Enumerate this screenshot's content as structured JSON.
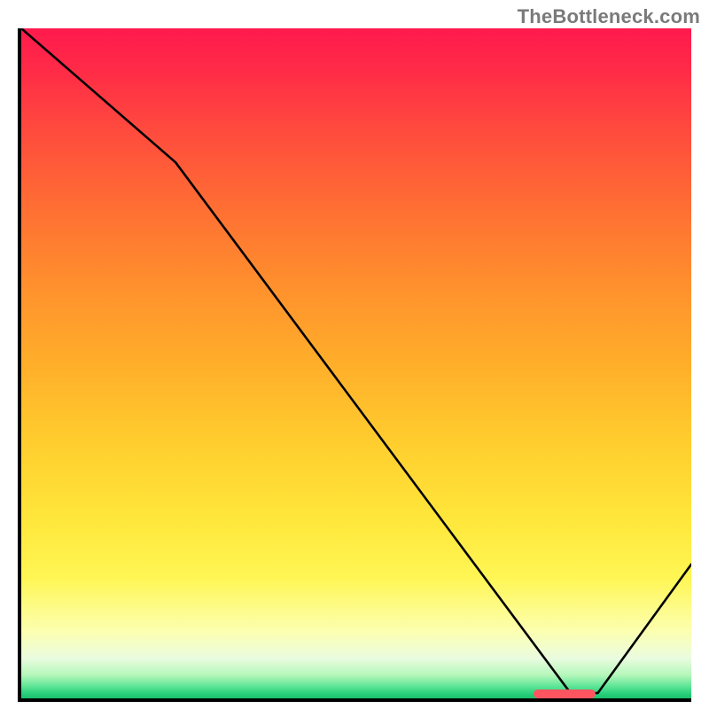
{
  "watermark": "TheBottleneck.com",
  "chart_data": {
    "type": "line",
    "title": "",
    "xlabel": "",
    "ylabel": "",
    "xlim": [
      0,
      100
    ],
    "ylim": [
      0,
      100
    ],
    "x": [
      0,
      23,
      82,
      86,
      100
    ],
    "values": [
      100,
      80,
      0.5,
      0.5,
      20
    ],
    "annotations": [
      {
        "name": "highlight-marker",
        "x": 80,
        "y": 0.5
      }
    ],
    "background_gradient": {
      "direction": "top-to-bottom",
      "stops": [
        {
          "pos": 0.0,
          "color": "#ff1a4d"
        },
        {
          "pos": 0.5,
          "color": "#ffae2a"
        },
        {
          "pos": 0.82,
          "color": "#fff654"
        },
        {
          "pos": 1.0,
          "color": "#19c06c"
        }
      ]
    }
  }
}
